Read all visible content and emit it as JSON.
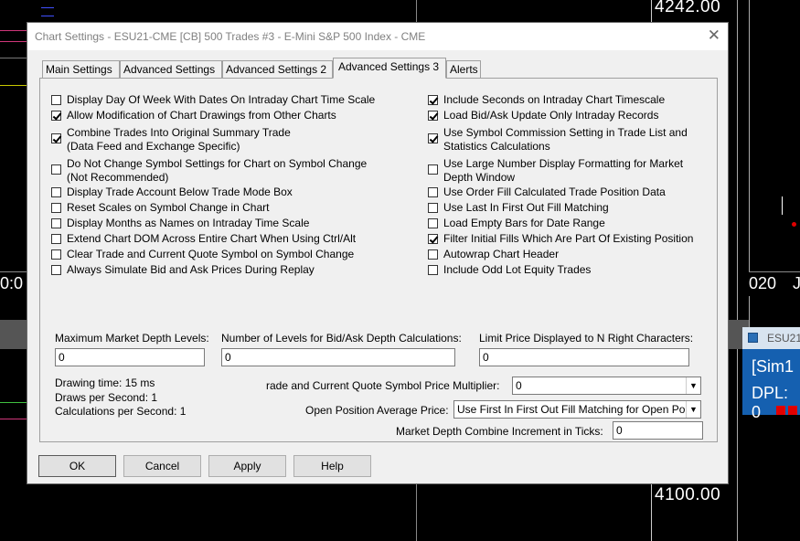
{
  "background": {
    "price_top": "4242.00",
    "price_bottom": "4100.00",
    "left_axis_label": "0:0",
    "right_axis_label_a": "020",
    "right_axis_label_b": "J",
    "side_window_title": "ESU21",
    "side_window_line1": "[Sim1",
    "side_window_line2": "DPL: 0"
  },
  "dialog": {
    "title": "Chart Settings - ESU21-CME [CB]  500 Trades  #3 - E-Mini S&P 500 Index - CME",
    "close_glyph": "✕",
    "tabs": [
      {
        "label": "Main Settings"
      },
      {
        "label": "Advanced Settings"
      },
      {
        "label": "Advanced Settings 2"
      },
      {
        "label": "Advanced Settings 3"
      },
      {
        "label": "Alerts"
      }
    ],
    "active_tab": "Advanced Settings 3",
    "left_checkboxes": [
      {
        "label": "Display Day Of Week With Dates On Intraday Chart Time Scale",
        "checked": false
      },
      {
        "label": "Allow Modification of Chart Drawings from Other Charts",
        "checked": true
      },
      {
        "label": "Combine Trades Into Original Summary Trade",
        "label2": "(Data Feed and Exchange Specific)",
        "checked": true
      },
      {
        "label": "Do Not Change Symbol Settings for Chart on Symbol Change",
        "label2": "(Not Recommended)",
        "checked": false
      },
      {
        "label": "Display Trade Account Below Trade Mode Box",
        "checked": false
      },
      {
        "label": "Reset Scales on Symbol Change in Chart",
        "checked": false
      },
      {
        "label": "Display Months as Names on Intraday Time Scale",
        "checked": false
      },
      {
        "label": "Extend Chart DOM Across Entire Chart When Using Ctrl/Alt",
        "checked": false
      },
      {
        "label": "Clear Trade and Current Quote Symbol on Symbol Change",
        "checked": false
      },
      {
        "label": "Always Simulate Bid and Ask Prices During Replay",
        "checked": false
      }
    ],
    "right_checkboxes": [
      {
        "label": "Include Seconds on Intraday Chart Timescale",
        "checked": true
      },
      {
        "label": "Load Bid/Ask Update Only Intraday Records",
        "checked": true
      },
      {
        "label": "Use Symbol Commission Setting in Trade List and",
        "label2": "Statistics Calculations",
        "checked": true
      },
      {
        "label": "Use Large Number Display Formatting for Market",
        "label2": "Depth Window",
        "checked": false
      },
      {
        "label": "Use Order Fill Calculated Trade Position Data",
        "checked": false
      },
      {
        "label": "Use Last In First Out Fill Matching",
        "checked": false
      },
      {
        "label": "Load Empty Bars for Date Range",
        "checked": false
      },
      {
        "label": "Filter Initial Fills Which Are Part Of Existing Position",
        "checked": true
      },
      {
        "label": "Autowrap Chart Header",
        "checked": false
      },
      {
        "label": "Include Odd Lot Equity Trades",
        "checked": false
      }
    ],
    "fields": {
      "max_depth_label": "Maximum Market Depth Levels:",
      "max_depth_value": "0",
      "bid_ask_levels_label": "Number of Levels for Bid/Ask Depth Calculations:",
      "bid_ask_levels_value": "0",
      "limit_price_label": "Limit Price Displayed to N Right Characters:",
      "limit_price_value": "0",
      "multiplier_label": "rade and Current Quote Symbol Price Multiplier:",
      "multiplier_value": "0",
      "avg_price_label": "Open Position Average Price:",
      "avg_price_value": "Use First In First Out Fill Matching for Open Po",
      "depth_increment_label": "Market Depth Combine Increment in Ticks:",
      "depth_increment_value": "0"
    },
    "stats": {
      "drawing_time": "Drawing time: 15 ms",
      "draws_per_second": "Draws per Second: 1",
      "calcs_per_second": "Calculations per Second: 1"
    },
    "buttons": {
      "ok": "OK",
      "cancel": "Cancel",
      "apply": "Apply",
      "help": "Help"
    }
  }
}
